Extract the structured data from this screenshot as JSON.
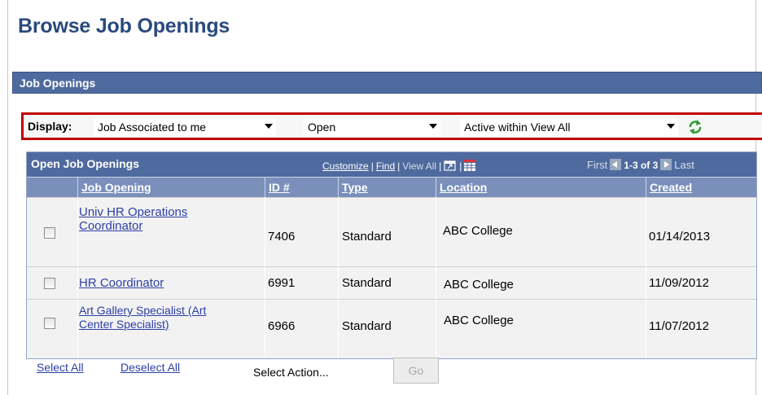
{
  "page": {
    "title": "Browse Job Openings"
  },
  "section": {
    "title": "Job Openings"
  },
  "display": {
    "label": "Display:",
    "filter1": "Job Associated to me",
    "filter2": "Open",
    "filter3": "Active within View All"
  },
  "grid": {
    "title": "Open Job Openings",
    "customize": "Customize",
    "find": "Find",
    "view_all": "View All",
    "first": "First",
    "count": "1-3 of 3",
    "last": "Last",
    "columns": [
      "Job Opening",
      "ID #",
      "Type",
      "Location",
      "Created"
    ],
    "rows": [
      {
        "title_line1": "Univ HR Operations",
        "title_line2": "Coordinator",
        "id": "7406",
        "type": "Standard",
        "location": "ABC College",
        "created": "01/14/2013"
      },
      {
        "title_line1": "HR Coordinator",
        "title_line2": "",
        "id": "6991",
        "type": "Standard",
        "location": "ABC College",
        "created": "11/09/2012"
      },
      {
        "title_line1": "Art Gallery Specialist (Art",
        "title_line2": "Center Specialist)",
        "id": "6966",
        "type": "Standard",
        "location": "ABC College",
        "created": "11/07/2012"
      }
    ]
  },
  "footer": {
    "select_all": "Select All",
    "deselect_all": "Deselect All",
    "select_action": "Select Action...",
    "go": "Go"
  },
  "colors": {
    "header_bar": "#4f6a9e",
    "column_header": "#7a90bb",
    "title": "#2a4a7e",
    "highlight_border": "#c00000",
    "link": "#2d3fa5"
  }
}
